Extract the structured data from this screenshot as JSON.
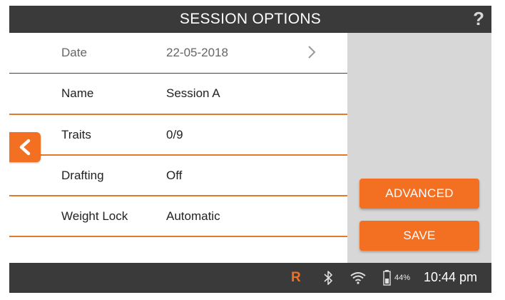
{
  "header": {
    "title": "SESSION OPTIONS",
    "help_glyph": "?"
  },
  "rows": [
    {
      "label": "Date",
      "value": "22-05-2018"
    },
    {
      "label": "Name",
      "value": "Session A"
    },
    {
      "label": "Traits",
      "value": "0/9"
    },
    {
      "label": "Drafting",
      "value": "Off"
    },
    {
      "label": "Weight Lock",
      "value": "Automatic"
    }
  ],
  "buttons": {
    "advanced": "ADVANCED",
    "save": "SAVE"
  },
  "status": {
    "indicator": "R",
    "battery": "44%",
    "time": "10:44 pm"
  },
  "colors": {
    "accent": "#f36f21",
    "bar": "#3a3a3a",
    "panel": "#d7d7d7",
    "divider": "#e37a2a"
  },
  "icons": [
    "help-icon",
    "chevron-right-icon",
    "back-arrow-icon",
    "bluetooth-icon",
    "wifi-icon",
    "battery-icon"
  ]
}
